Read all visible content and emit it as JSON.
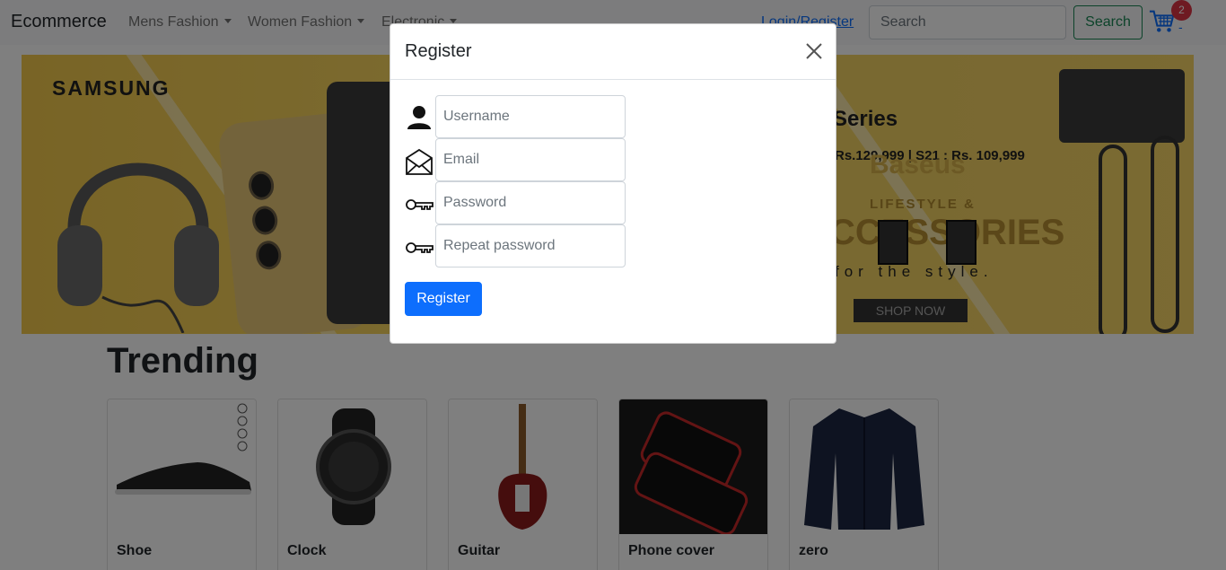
{
  "navbar": {
    "brand": "Ecommerce",
    "menu": [
      "Mens Fashion",
      "Women Fashion",
      "Electronic"
    ],
    "login_label": "Login/Register",
    "search_placeholder": "Search",
    "search_button": "Search",
    "cart_count": "2",
    "cart_suffix": "-"
  },
  "banner": {
    "left_brand": "SAMSUNG",
    "series_text": "Series",
    "price_text": "Rs.129,999 |  S21 : Rs. 109,999",
    "baseus_text": "Baseus",
    "lifestyle_text": "LIFESTYLE &",
    "accessories_text": "CCESSORIES",
    "style_text": "for the style.",
    "shop_now": "SHOP NOW"
  },
  "trending": {
    "title": "Trending",
    "items": [
      {
        "name": "Shoe"
      },
      {
        "name": "Clock"
      },
      {
        "name": "Guitar"
      },
      {
        "name": "Phone cover"
      },
      {
        "name": "zero"
      }
    ]
  },
  "modal": {
    "title": "Register",
    "fields": [
      {
        "placeholder": "Username",
        "icon": "person-icon"
      },
      {
        "placeholder": "Email",
        "icon": "envelope-icon"
      },
      {
        "placeholder": "Password",
        "icon": "key-icon"
      },
      {
        "placeholder": "Repeat password",
        "icon": "key-icon"
      }
    ],
    "submit_label": "Register"
  },
  "colors": {
    "primary": "#0d6efd",
    "success": "#198754",
    "danger": "#dc3545",
    "backdrop": "rgba(0,0,0,0.5)"
  }
}
